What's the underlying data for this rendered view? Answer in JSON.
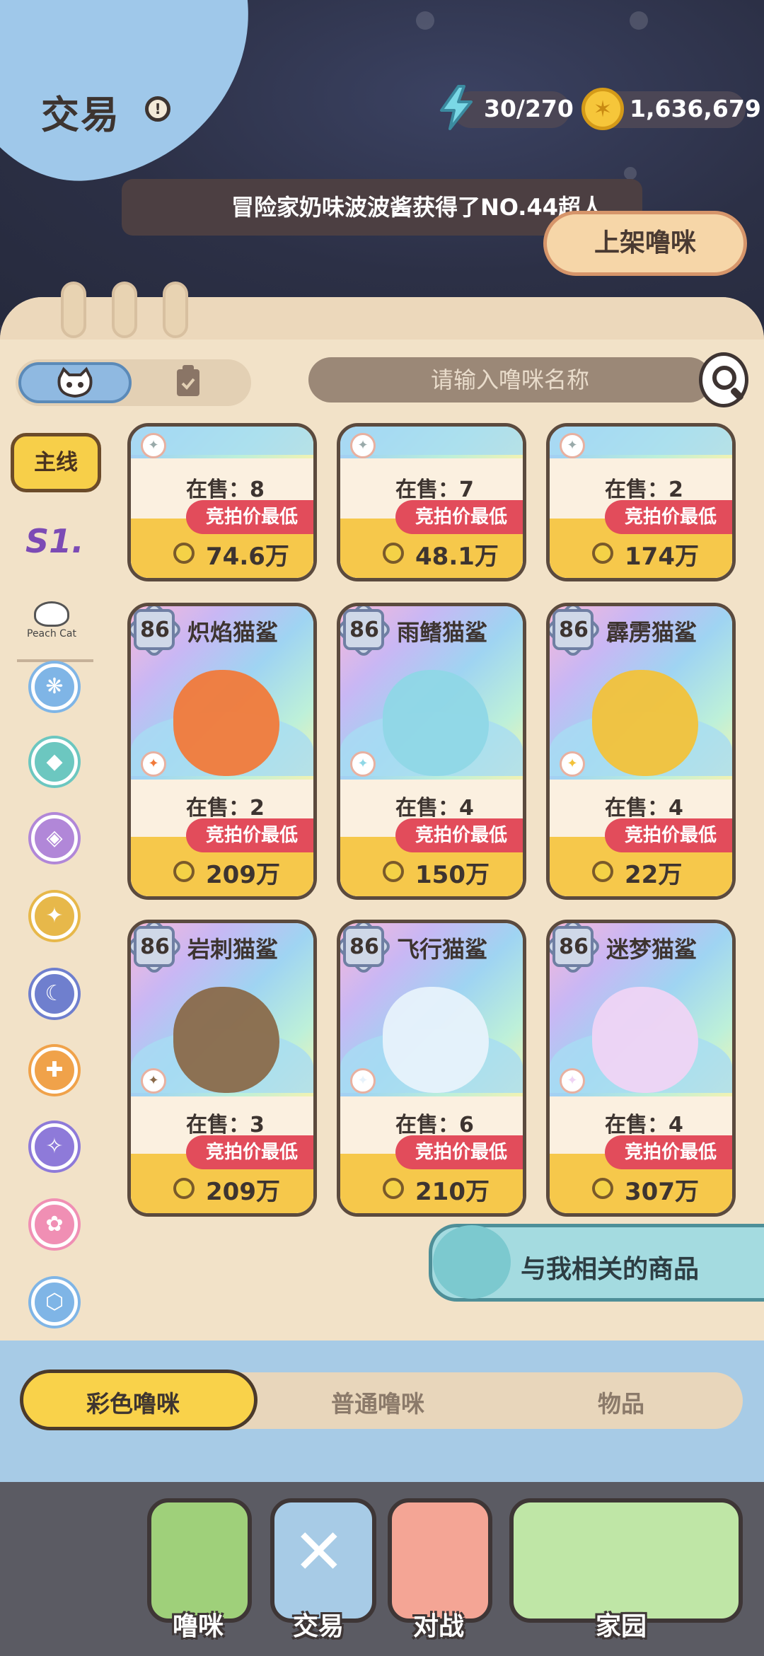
{
  "header": {
    "title": "交易",
    "info_icon": "info-icon",
    "energy": "30/270",
    "coins": "1,636,679",
    "ticker": "冒险家奶味波波酱获得了NO.44超人",
    "list_button": "上架噜咪"
  },
  "filters": {
    "search_placeholder": "请输入噜咪名称",
    "seg_icons": [
      "cat-face-icon",
      "clipboard-icon"
    ]
  },
  "sidebar": {
    "main_label": "主线",
    "season_label": "S1.",
    "brand_label": "Peach Cat",
    "icons": [
      {
        "name": "water-drop-icon",
        "color": "#7fb5e6",
        "glyph": "❋"
      },
      {
        "name": "crystal-icon",
        "color": "#6cc7c0",
        "glyph": "◆"
      },
      {
        "name": "gem-icon",
        "color": "#b187d8",
        "glyph": "◈"
      },
      {
        "name": "flame-icon",
        "color": "#e7b84a",
        "glyph": "✦"
      },
      {
        "name": "moon-icon",
        "color": "#6f7fce",
        "glyph": "☾"
      },
      {
        "name": "fist-icon",
        "color": "#f0a24a",
        "glyph": "✚"
      },
      {
        "name": "star-icon",
        "color": "#8e7ad9",
        "glyph": "✧"
      },
      {
        "name": "flower-icon",
        "color": "#f08fb4",
        "glyph": "✿"
      },
      {
        "name": "shield-icon",
        "color": "#7fb5e6",
        "glyph": "⬡"
      }
    ]
  },
  "cards_top": [
    {
      "sale": "在售：8",
      "tag": "竞拍价最低",
      "price": "74.6万"
    },
    {
      "sale": "在售：7",
      "tag": "竞拍价最低",
      "price": "48.1万"
    },
    {
      "sale": "在售：2",
      "tag": "竞拍价最低",
      "price": "174万"
    }
  ],
  "cards": [
    {
      "level": "86",
      "name": "炽焰猫鲨",
      "sale": "在售：2",
      "tag": "竞拍价最低",
      "price": "209万",
      "color": "#f17a3a"
    },
    {
      "level": "86",
      "name": "雨鳍猫鲨",
      "sale": "在售：4",
      "tag": "竞拍价最低",
      "price": "150万",
      "color": "#8fd7e6"
    },
    {
      "level": "86",
      "name": "霹雳猫鲨",
      "sale": "在售：4",
      "tag": "竞拍价最低",
      "price": "22万",
      "color": "#f2c23a"
    },
    {
      "level": "86",
      "name": "岩刺猫鲨",
      "sale": "在售：3",
      "tag": "竞拍价最低",
      "price": "209万",
      "color": "#8a6a4a"
    },
    {
      "level": "86",
      "name": "飞行猫鲨",
      "sale": "在售：6",
      "tag": "竞拍价最低",
      "price": "210万",
      "color": "#e7f2fb"
    },
    {
      "level": "86",
      "name": "迷梦猫鲨",
      "sale": "在售：4",
      "tag": "竞拍价最低",
      "price": "307万",
      "color": "#efd4f4"
    }
  ],
  "related_button": "与我相关的商品",
  "category_tabs": [
    "彩色噜咪",
    "普通噜咪",
    "物品"
  ],
  "nav": [
    {
      "label": "噜咪",
      "color": "#9fd07a"
    },
    {
      "label": "交易",
      "color": "#a7cbe6"
    },
    {
      "label": "对战",
      "color": "#f4a595"
    },
    {
      "label": "家园",
      "color": "#bfe6a6"
    }
  ]
}
